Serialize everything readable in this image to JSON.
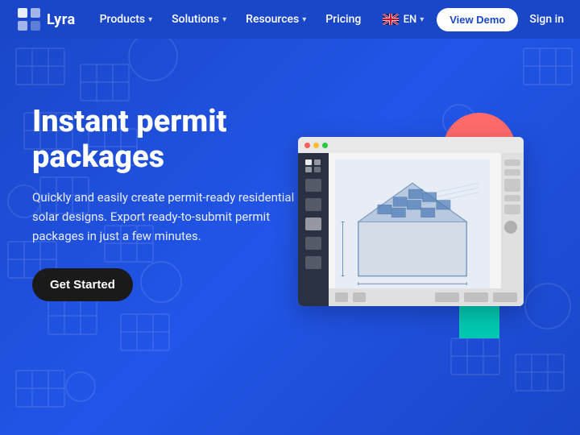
{
  "nav": {
    "logo_text": "Lyra",
    "items": [
      {
        "label": "Products",
        "has_dropdown": true
      },
      {
        "label": "Solutions",
        "has_dropdown": true
      },
      {
        "label": "Resources",
        "has_dropdown": true
      },
      {
        "label": "Pricing",
        "has_dropdown": false
      }
    ],
    "language": "EN",
    "view_demo_label": "View Demo",
    "signin_label": "Sign in"
  },
  "hero": {
    "title": "Instant permit packages",
    "subtitle": "Quickly and easily create permit-ready residential solar designs. Export ready-to-submit permit packages in just a few minutes.",
    "cta_label": "Get Started"
  },
  "colors": {
    "brand_blue": "#1a47c8",
    "coral": "#FF6B6B",
    "teal": "#00C9B1",
    "dark_btn": "#1a1a1a",
    "white": "#ffffff"
  }
}
